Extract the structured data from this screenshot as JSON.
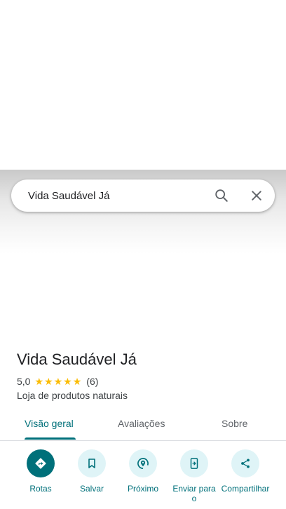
{
  "search": {
    "query": "Vida Saudável Já"
  },
  "place": {
    "title": "Vida Saudável Já",
    "rating": "5,0",
    "stars": 5,
    "review_count": "(6)",
    "category": "Loja de produtos naturais"
  },
  "tabs": [
    {
      "label": "Visão geral",
      "active": true
    },
    {
      "label": "Avaliações",
      "active": false
    },
    {
      "label": "Sobre",
      "active": false
    }
  ],
  "actions": [
    {
      "label": "Rotas",
      "icon": "directions-icon"
    },
    {
      "label": "Salvar",
      "icon": "bookmark-icon"
    },
    {
      "label": "Próximo",
      "icon": "nearby-icon"
    },
    {
      "label": "Enviar para o",
      "icon": "send-to-phone-icon"
    },
    {
      "label": "Compartilhar",
      "icon": "share-icon"
    }
  ],
  "colors": {
    "accent": "#00707a",
    "action_bg": "#dff4f7",
    "star": "#fbbc04"
  }
}
